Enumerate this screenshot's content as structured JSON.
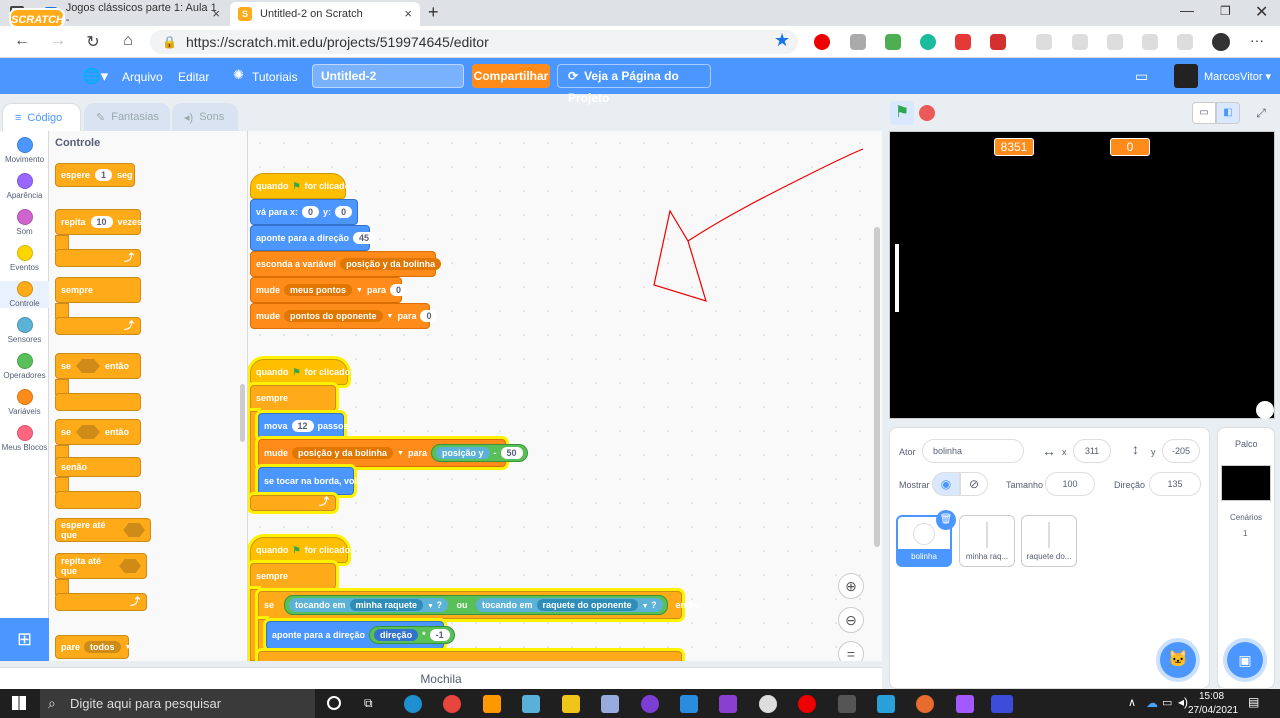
{
  "browser": {
    "tabs": [
      {
        "title": "Jogos clássicos parte 1: Aula 1 -"
      },
      {
        "title": "Untitled-2 on Scratch"
      }
    ],
    "url": "https://scratch.mit.edu/projects/519974645/editor"
  },
  "menu": {
    "logo": "SCRATCH",
    "file": "Arquivo",
    "edit": "Editar",
    "tutorials": "Tutoriais",
    "project_title": "Untitled-2",
    "share": "Compartilhar",
    "see_project": "Veja a Página do Projeto",
    "user": "MarcosVitor"
  },
  "editor_tabs": {
    "code": "Código",
    "costumes": "Fantasias",
    "sounds": "Sons"
  },
  "categories": [
    {
      "label": "Movimento",
      "color": "#4c97ff"
    },
    {
      "label": "Aparência",
      "color": "#9966ff"
    },
    {
      "label": "Som",
      "color": "#cf63cf"
    },
    {
      "label": "Eventos",
      "color": "#ffd500"
    },
    {
      "label": "Controle",
      "color": "#ffab19"
    },
    {
      "label": "Sensores",
      "color": "#5cb1d6"
    },
    {
      "label": "Operadores",
      "color": "#59c059"
    },
    {
      "label": "Variáveis",
      "color": "#ff8c1a"
    },
    {
      "label": "Meus Blocos",
      "color": "#ff6680"
    }
  ],
  "palette": {
    "heading": "Controle",
    "wait": "espere",
    "wait_val": "1",
    "wait_unit": "seg",
    "repeat": "repita",
    "repeat_val": "10",
    "repeat_unit": "vezes",
    "forever": "sempre",
    "if": "se",
    "then": "então",
    "if2": "se",
    "then2": "então",
    "else": "senão",
    "wait_until": "espere até que",
    "repeat_until": "repita até que",
    "stop": "pare",
    "stop_val": "todos"
  },
  "script1": {
    "hat": "quando",
    "hat_end": "for clicado",
    "goto": "vá para x:",
    "goto_x": "0",
    "goto_y_label": "y:",
    "goto_y": "0",
    "point": "aponte para a direção",
    "point_val": "45",
    "hide_var": "esconda a variável",
    "hide_var_name": "posição y da bolinha",
    "set1": "mude",
    "set1_var": "meus pontos",
    "set1_to": "para",
    "set1_val": "0",
    "set2": "mude",
    "set2_var": "pontos do oponente",
    "set2_to": "para",
    "set2_val": "0"
  },
  "script2": {
    "hat": "quando",
    "hat_end": "for clicado",
    "forever": "sempre",
    "move": "mova",
    "move_val": "12",
    "move_unit": "passos",
    "set": "mude",
    "set_var": "posição y da bolinha",
    "set_to": "para",
    "set_rep": "posição y",
    "set_op": "-",
    "set_val": "50",
    "bounce": "se tocar na borda, volte"
  },
  "script3": {
    "hat": "quando",
    "hat_end": "for clicado",
    "forever": "sempre",
    "if": "se",
    "touch1": "tocando em",
    "touch1_val": "minha raquete",
    "q1": "?",
    "or": "ou",
    "touch2": "tocando em",
    "touch2_val": "raquete do oponente",
    "q2": "?",
    "then": "então",
    "point": "aponte para a direção",
    "dir_rep": "direção",
    "mul": "*",
    "mul_val": "-1"
  },
  "mochila": "Mochila",
  "stage": {
    "score_left": "8351",
    "score_right": "0"
  },
  "sprite": {
    "actor_label": "Ator",
    "actor_name": "bolinha",
    "x_label": "x",
    "x_val": "311",
    "y_label": "y",
    "y_val": "-205",
    "show_label": "Mostrar",
    "size_label": "Tamanho",
    "size_val": "100",
    "dir_label": "Direção",
    "dir_val": "135",
    "thumbs": [
      "bolinha",
      "minha raq...",
      "raquete do..."
    ]
  },
  "stage_panel": {
    "title": "Palco",
    "backdrops_label": "Cenários",
    "backdrops_count": "1"
  },
  "taskbar": {
    "search": "Digite aqui para pesquisar",
    "time": "15:08",
    "date": "27/04/2021"
  }
}
